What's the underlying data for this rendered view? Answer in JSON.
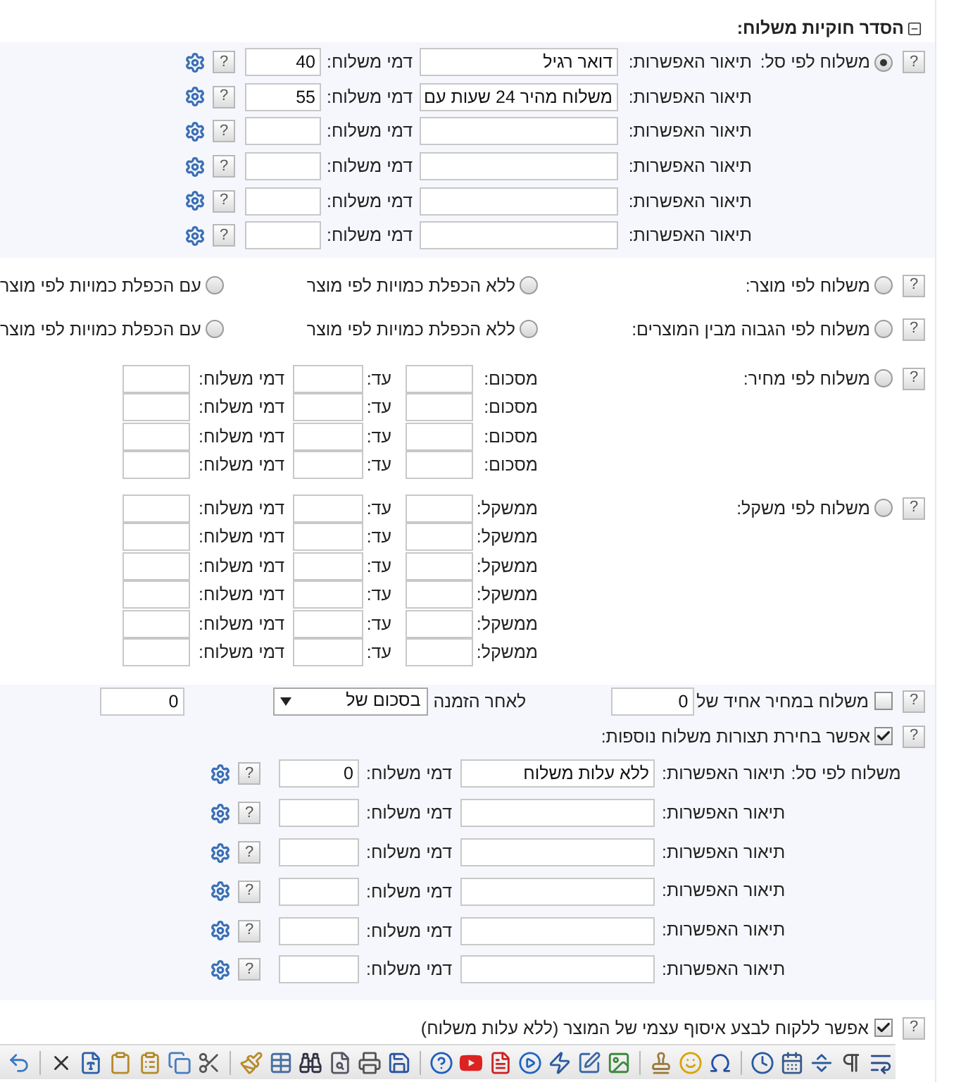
{
  "section": {
    "title": "הסדר חוקיות משלוח:",
    "expanded": true
  },
  "shipping_methods": [
    {
      "kind": "basket",
      "label": "משלוח לפי סל:",
      "selected": true,
      "help": "?",
      "rows": [
        {
          "description_label": "תיאור האפשרות:",
          "description": "דואר רגיל",
          "fee_label": "דמי משלוח:",
          "fee": "40",
          "help": "?"
        },
        {
          "description_label": "תיאור האפשרות:",
          "description": "משלוח מהיר 24 שעות עם",
          "fee_label": "דמי משלוח:",
          "fee": "55",
          "help": "?"
        },
        {
          "description_label": "תיאור האפשרות:",
          "fee_label": "דמי משלוח:",
          "help": "?"
        },
        {
          "description_label": "תיאור האפשרות:",
          "fee_label": "דמי משלוח:",
          "help": "?"
        },
        {
          "description_label": "תיאור האפשרות:",
          "fee_label": "דמי משלוח:",
          "help": "?"
        },
        {
          "description_label": "תיאור האפשרות:",
          "fee_label": "דמי משלוח:",
          "help": "?"
        }
      ]
    },
    {
      "kind": "product",
      "label": "משלוח לפי מוצר:",
      "selected": false,
      "help": "?",
      "options": [
        {
          "label": "ללא הכפלת כמויות לפי מוצר",
          "selected": false
        },
        {
          "label": "עם הכפלת כמויות לפי מוצר",
          "selected": false
        }
      ]
    },
    {
      "kind": "product",
      "label": "משלוח לפי הגבוה מבין המוצרים:",
      "selected": false,
      "help": "?",
      "options": [
        {
          "label": "ללא הכפלת כמויות לפי מוצר",
          "selected": false
        },
        {
          "label": "עם הכפלת כמויות לפי מוצר",
          "selected": false
        }
      ]
    },
    {
      "kind": "tiers",
      "label": "משלוח לפי מחיר:",
      "selected": false,
      "help": "?",
      "rows": [
        {
          "from_label": "מסכום:",
          "to_label": "עד:",
          "fee_label": "דמי משלוח:"
        },
        {
          "from_label": "מסכום:",
          "to_label": "עד:",
          "fee_label": "דמי משלוח:"
        },
        {
          "from_label": "מסכום:",
          "to_label": "עד:",
          "fee_label": "דמי משלוח:"
        },
        {
          "from_label": "מסכום:",
          "to_label": "עד:",
          "fee_label": "דמי משלוח:"
        }
      ]
    },
    {
      "kind": "tiers",
      "label": "משלוח לפי משקל:",
      "selected": false,
      "help": "?",
      "rows": [
        {
          "from_label": "ממשקל:",
          "to_label": "עד:",
          "fee_label": "דמי משלוח:"
        },
        {
          "from_label": "ממשקל:",
          "to_label": "עד:",
          "fee_label": "דמי משלוח:"
        },
        {
          "from_label": "ממשקל:",
          "to_label": "עד:",
          "fee_label": "דמי משלוח:"
        },
        {
          "from_label": "ממשקל:",
          "to_label": "עד:",
          "fee_label": "דמי משלוח:"
        },
        {
          "from_label": "ממשקל:",
          "to_label": "עד:",
          "fee_label": "דמי משלוח:"
        },
        {
          "from_label": "ממשקל:",
          "to_label": "עד:",
          "fee_label": "דמי משלוח:"
        }
      ]
    }
  ],
  "flat_rate": {
    "checked": false,
    "help": "?",
    "label": "משלוח במחיר אחיד של",
    "amount": "0",
    "after_label": "לאחר הזמנה",
    "condition": "בסכום של",
    "threshold": "0"
  },
  "extra_options": {
    "checked": true,
    "help": "?",
    "label": "אפשר בחירת תצורות משלוח נוספות:",
    "rows": [
      {
        "prefix": "משלוח לפי סל:",
        "description_label": "תיאור האפשרות:",
        "description": "ללא עלות משלוח",
        "fee_label": "דמי משלוח:",
        "fee": "0",
        "help": "?"
      },
      {
        "description_label": "תיאור האפשרות:",
        "fee_label": "דמי משלוח:",
        "help": "?"
      },
      {
        "description_label": "תיאור האפשרות:",
        "fee_label": "דמי משלוח:",
        "help": "?"
      },
      {
        "description_label": "תיאור האפשרות:",
        "fee_label": "דמי משלוח:",
        "help": "?"
      },
      {
        "description_label": "תיאור האפשרות:",
        "fee_label": "דמי משלוח:",
        "help": "?"
      },
      {
        "description_label": "תיאור האפשרות:",
        "fee_label": "דמי משלוח:",
        "help": "?"
      }
    ]
  },
  "pickup": {
    "checked": true,
    "help": "?",
    "label": "אפשר ללקוח לבצע איסוף עצמי של המוצר (ללא עלות משלוח)"
  }
}
